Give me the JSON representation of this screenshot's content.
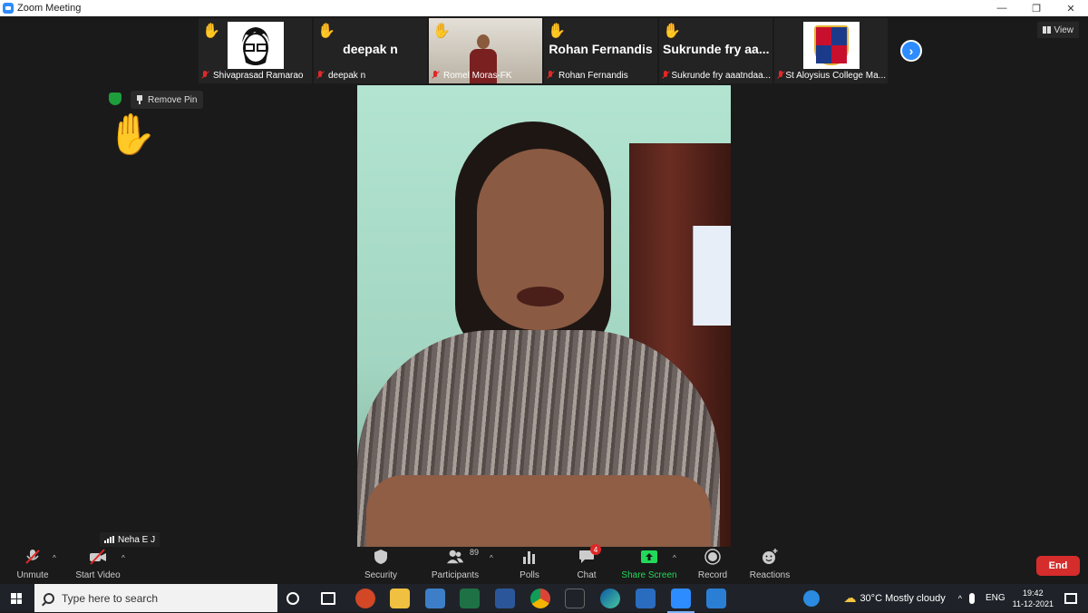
{
  "window": {
    "title": "Zoom Meeting",
    "controls": [
      "—",
      "❐",
      "✕"
    ]
  },
  "view_button": {
    "label": "View"
  },
  "thumbnails": [
    {
      "name": "Shivaprasad Ramarao",
      "display": "avatar",
      "hand_raised": true
    },
    {
      "name": "deepak n",
      "big_name": "deepak n",
      "display": "name",
      "hand_raised": true
    },
    {
      "name": "Romel Moras-FK",
      "display": "video",
      "hand_raised": true
    },
    {
      "name": "Rohan Fernandis",
      "big_name": "Rohan Fernandis",
      "display": "name",
      "hand_raised": true
    },
    {
      "name": "Sukrunde fry aaatndaa...",
      "big_name": "Sukrunde fry aa...",
      "display": "name",
      "hand_raised": true
    },
    {
      "name": "St Aloysius College Ma...",
      "display": "crest",
      "hand_raised": false
    }
  ],
  "pin": {
    "label": "Remove Pin"
  },
  "self_view": {
    "name": "Neha E J"
  },
  "toolbar": {
    "unmute": "Unmute",
    "start_video": "Start Video",
    "security": "Security",
    "participants": "Participants",
    "participants_count": "89",
    "polls": "Polls",
    "chat": "Chat",
    "chat_badge": "4",
    "share_screen": "Share Screen",
    "record": "Record",
    "reactions": "Reactions",
    "end": "End"
  },
  "taskbar": {
    "search_placeholder": "Type here to search",
    "weather": "30°C  Mostly cloudy",
    "language": "ENG",
    "time": "19:42",
    "date": "11-12-2021"
  },
  "colors": {
    "accent": "#2d8cff",
    "end": "#d52c2c",
    "green": "#23d959",
    "hand": "#f6c541"
  }
}
